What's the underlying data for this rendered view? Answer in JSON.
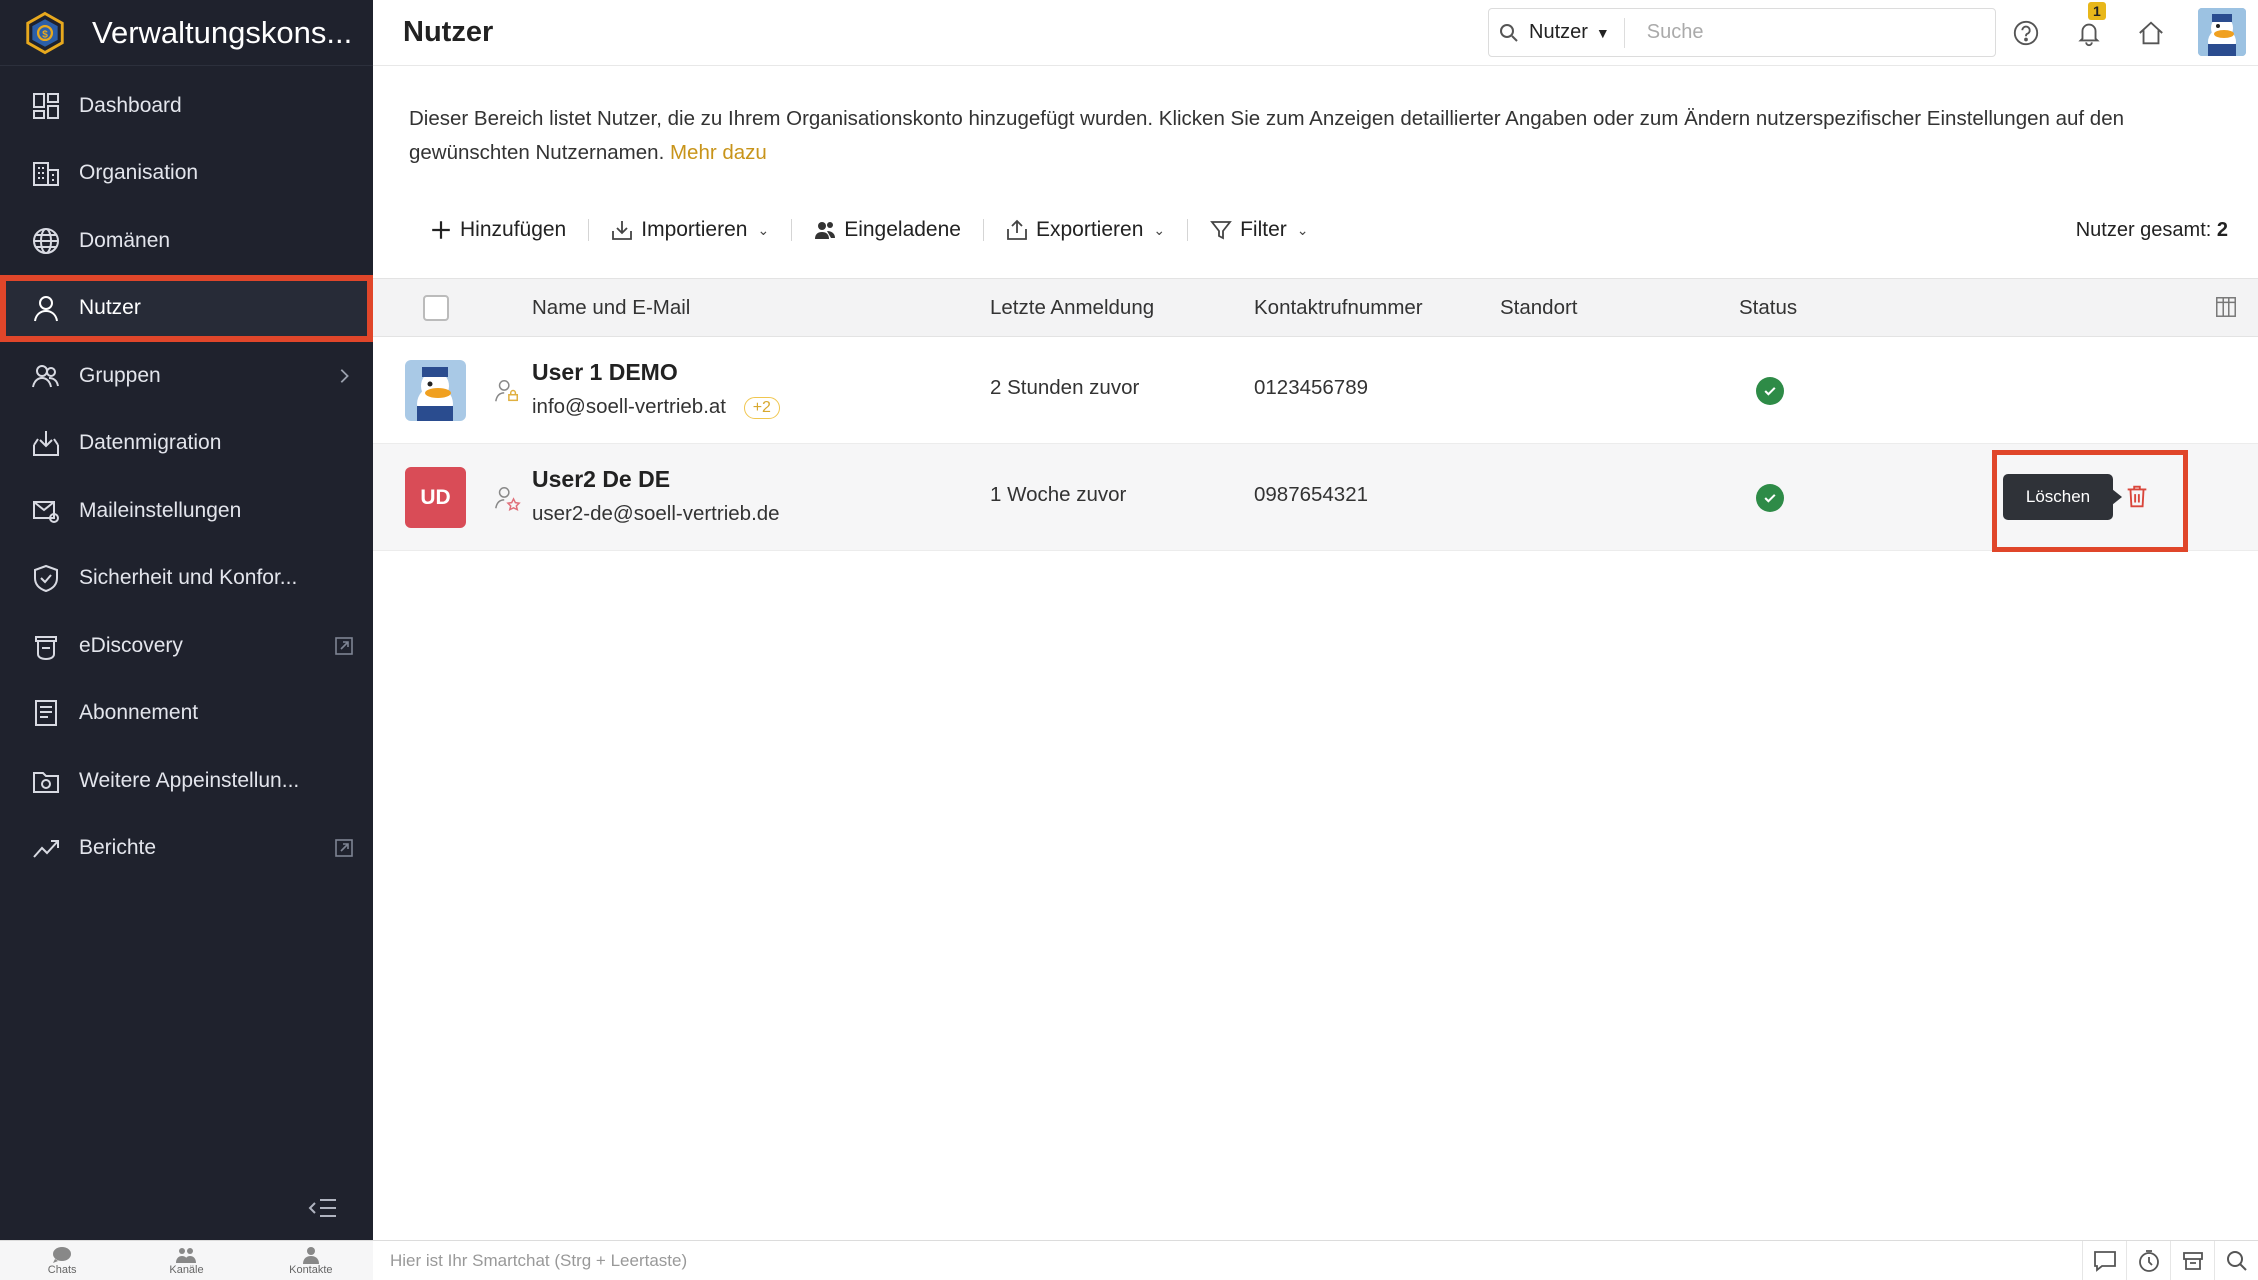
{
  "sidebar": {
    "brand_title": "Verwaltungskons...",
    "items": [
      {
        "label": "Dashboard",
        "icon": "dashboard-icon"
      },
      {
        "label": "Organisation",
        "icon": "building-icon"
      },
      {
        "label": "Domänen",
        "icon": "globe-icon"
      },
      {
        "label": "Nutzer",
        "icon": "user-icon",
        "active": true
      },
      {
        "label": "Gruppen",
        "icon": "group-icon",
        "trailing": "chevron-right-icon"
      },
      {
        "label": "Datenmigration",
        "icon": "download-tray-icon"
      },
      {
        "label": "Maileinstellungen",
        "icon": "mail-settings-icon"
      },
      {
        "label": "Sicherheit und Konfor...",
        "icon": "shield-icon"
      },
      {
        "label": "eDiscovery",
        "icon": "ediscovery-icon",
        "trailing": "external-link-icon"
      },
      {
        "label": "Abonnement",
        "icon": "subscription-icon"
      },
      {
        "label": "Weitere Appeinstellun...",
        "icon": "app-settings-icon"
      },
      {
        "label": "Berichte",
        "icon": "trend-icon",
        "trailing": "external-link-icon"
      }
    ]
  },
  "header": {
    "title": "Nutzer",
    "search_scope": "Nutzer",
    "search_placeholder": "Suche",
    "notification_count": "1"
  },
  "content": {
    "description": "Dieser Bereich listet Nutzer, die zu Ihrem Organisationskonto hinzugefügt wurden. Klicken Sie zum Anzeigen detaillierter Angaben oder zum Ändern nutzerspezifischer Einstellungen auf den gewünschten Nutzernamen.",
    "more_link": "Mehr dazu"
  },
  "toolbar": {
    "add": "Hinzufügen",
    "import": "Importieren",
    "invited": "Eingeladene",
    "export": "Exportieren",
    "filter": "Filter",
    "total_label": "Nutzer gesamt:",
    "total_value": "2"
  },
  "table": {
    "columns": [
      "Name und E-Mail",
      "Letzte Anmeldung",
      "Kontaktrufnummer",
      "Standort",
      "Status"
    ],
    "rows": [
      {
        "name": "User 1 DEMO",
        "email": "info@soell-vertrieb.at",
        "extra": "+2",
        "last_login": "2 Stunden zuvor",
        "phone": "0123456789",
        "location": "",
        "status": "active"
      },
      {
        "name": "User2 De DE",
        "initials": "UD",
        "email": "user2-de@soell-vertrieb.de",
        "last_login": "1 Woche zuvor",
        "phone": "0987654321",
        "location": "",
        "status": "active",
        "tooltip": "Löschen"
      }
    ]
  },
  "bottombar": {
    "tabs": [
      "Chats",
      "Kanäle",
      "Kontakte"
    ],
    "smartchat_placeholder": "Hier ist Ihr Smartchat (Strg + Leertaste)"
  },
  "colors": {
    "sidebar_bg": "#1f222d",
    "highlight": "#e0462a",
    "status_ok": "#2e8b47",
    "link": "#c8941a",
    "initials_bg": "#d94c57"
  }
}
